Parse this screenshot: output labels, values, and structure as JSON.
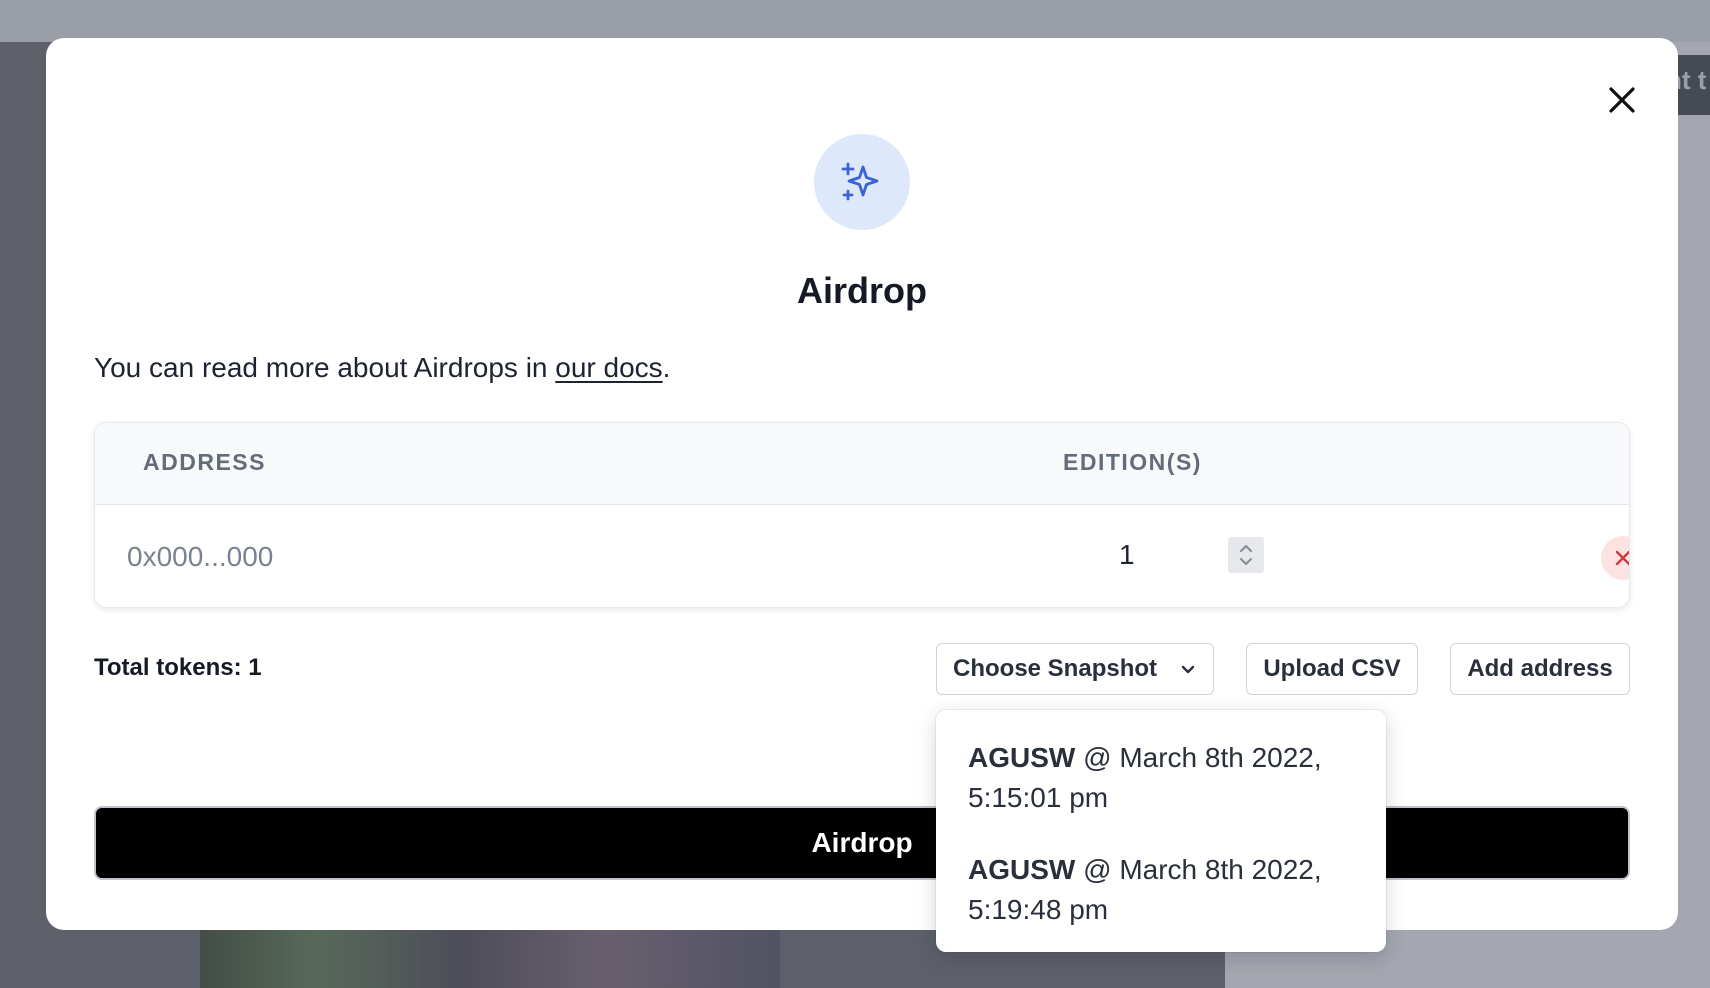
{
  "background": {
    "partial_text": "nt t"
  },
  "modal": {
    "title": "Airdrop",
    "description_prefix": "You can read more about Airdrops in ",
    "docs_link_label": "our docs",
    "description_suffix": ".",
    "icon": "sparkles-icon",
    "close_icon": "close-icon"
  },
  "table": {
    "headers": {
      "address": "ADDRESS",
      "editions": "EDITION(S)"
    },
    "rows": [
      {
        "address_placeholder": "0x000...000",
        "address_value": "",
        "editions": "1"
      }
    ]
  },
  "footer": {
    "total_tokens": "Total tokens: 1",
    "choose_snapshot_label": "Choose Snapshot",
    "upload_csv_label": "Upload CSV",
    "add_address_label": "Add address",
    "airdrop_button_label": "Airdrop"
  },
  "snapshot_dropdown": {
    "items": [
      {
        "name": "AGUSW",
        "separator": " @ ",
        "date": "March 8th 2022,",
        "time": "5:15:01 pm"
      },
      {
        "name": "AGUSW",
        "separator": " @ ",
        "date": "March 8th 2022,",
        "time": "5:19:48 pm"
      }
    ]
  },
  "colors": {
    "accent_blue": "#3b63d9",
    "icon_circle_bg": "#dde8fb",
    "danger": "#d23a3a",
    "danger_bg": "#fbe3e3",
    "primary_button": "#000000"
  }
}
